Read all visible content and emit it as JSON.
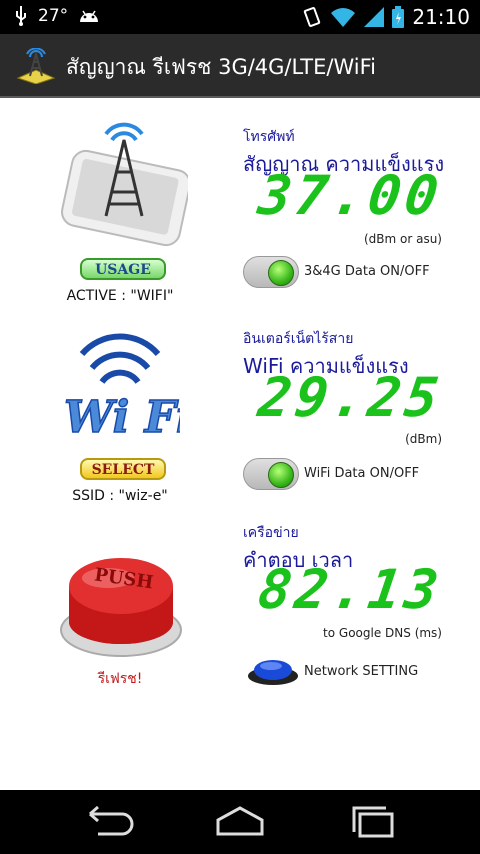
{
  "status_bar": {
    "temperature": "27°",
    "time": "21:10",
    "icons": [
      "usb-icon",
      "android-icon",
      "vibrate-icon",
      "wifi-icon",
      "signal-icon",
      "battery-icon"
    ]
  },
  "action_bar": {
    "title": "สัญญาณ รีเฟรช 3G/4G/LTE/WiFi",
    "logo": "signal-tower-logo"
  },
  "cellular": {
    "label": "โทรศัพท์",
    "title": "สัญญาณ ความแข็งแรง",
    "value": "37.00",
    "unit": "(dBm or asu)",
    "toggle_label": "3&4G Data ON/OFF",
    "toggle_on": true,
    "badge": "USAGE",
    "caption": "ACTIVE : \"WIFI\""
  },
  "wifi": {
    "label": "อินเตอร์เน็ตไร้สาย",
    "title": "WiFi ความแข็งแรง",
    "value": "29.25",
    "unit": "(dBm)",
    "toggle_label": "WiFi Data ON/OFF",
    "toggle_on": true,
    "badge": "SELECT",
    "caption": "SSID : \"wiz-e\"",
    "logo_text": "Wi Fi"
  },
  "network": {
    "label": "เครือข่าย",
    "title": "คำตอบ เวลา",
    "value": "82.13",
    "unit": "to Google DNS (ms)",
    "button_label": "Network SETTING",
    "push_text": "PUSH",
    "caption": "รีเฟรช!"
  },
  "colors": {
    "digit_green": "#1cc21c",
    "label_blue": "#1a1a9a",
    "refresh_red": "#c01818"
  }
}
